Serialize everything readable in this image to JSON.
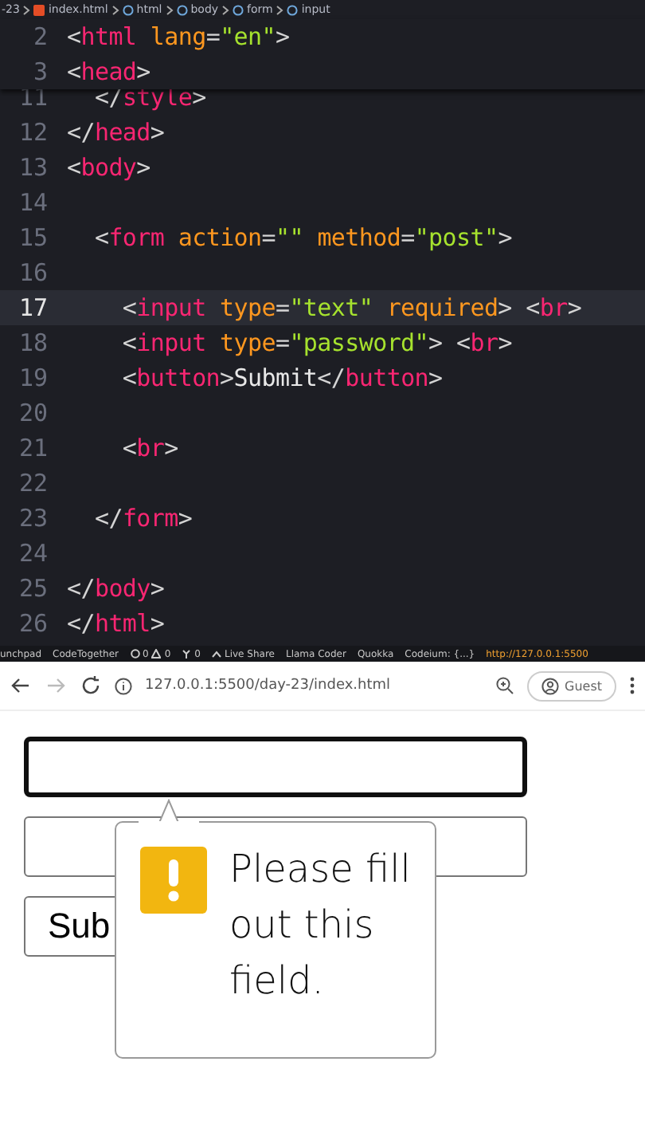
{
  "breadcrumb": [
    {
      "kind": "folder",
      "label": "-23"
    },
    {
      "kind": "file",
      "label": "index.html"
    },
    {
      "kind": "element",
      "label": "html"
    },
    {
      "kind": "element",
      "label": "body"
    },
    {
      "kind": "element",
      "label": "form"
    },
    {
      "kind": "element",
      "label": "input"
    }
  ],
  "sticky_lines": [
    {
      "number": "2",
      "current": false,
      "tokens": [
        {
          "kind": "punct",
          "text": "<"
        },
        {
          "kind": "tag",
          "text": "html"
        },
        {
          "kind": "attr",
          "text": " lang"
        },
        {
          "kind": "punct",
          "text": "="
        },
        {
          "kind": "string",
          "text": "\"en\""
        },
        {
          "kind": "punct",
          "text": ">"
        }
      ]
    },
    {
      "number": "3",
      "current": false,
      "tokens": [
        {
          "kind": "punct",
          "text": "<"
        },
        {
          "kind": "tag",
          "text": "head"
        },
        {
          "kind": "punct",
          "text": ">"
        }
      ]
    }
  ],
  "code_lines": [
    {
      "number": "11",
      "current": false,
      "tokens": [
        {
          "kind": "punct",
          "text": "  </"
        },
        {
          "kind": "tag",
          "text": "style"
        },
        {
          "kind": "punct",
          "text": ">"
        }
      ]
    },
    {
      "number": "12",
      "current": false,
      "tokens": [
        {
          "kind": "punct",
          "text": "</"
        },
        {
          "kind": "tag",
          "text": "head"
        },
        {
          "kind": "punct",
          "text": ">"
        }
      ]
    },
    {
      "number": "13",
      "current": false,
      "tokens": [
        {
          "kind": "punct",
          "text": "<"
        },
        {
          "kind": "tag",
          "text": "body"
        },
        {
          "kind": "punct",
          "text": ">"
        }
      ]
    },
    {
      "number": "14",
      "current": false
    },
    {
      "number": "15",
      "current": false,
      "tokens": [
        {
          "kind": "punct",
          "text": "  <"
        },
        {
          "kind": "tag",
          "text": "form"
        },
        {
          "kind": "attr",
          "text": " action"
        },
        {
          "kind": "punct",
          "text": "="
        },
        {
          "kind": "string",
          "text": "\"\""
        },
        {
          "kind": "attr",
          "text": " method"
        },
        {
          "kind": "punct",
          "text": "="
        },
        {
          "kind": "string",
          "text": "\"post\""
        },
        {
          "kind": "punct",
          "text": ">"
        }
      ]
    },
    {
      "number": "16",
      "current": false
    },
    {
      "number": "17",
      "current": true,
      "tokens": [
        {
          "kind": "punct",
          "text": "    <"
        },
        {
          "kind": "tag",
          "text": "input"
        },
        {
          "kind": "attr",
          "text": " type"
        },
        {
          "kind": "punct",
          "text": "="
        },
        {
          "kind": "string",
          "text": "\"text\""
        },
        {
          "kind": "attr",
          "text": " required"
        },
        {
          "kind": "punct",
          "text": "> <"
        },
        {
          "kind": "tag",
          "text": "br"
        },
        {
          "kind": "punct",
          "text": ">"
        }
      ]
    },
    {
      "number": "18",
      "current": false,
      "tokens": [
        {
          "kind": "punct",
          "text": "    <"
        },
        {
          "kind": "tag",
          "text": "input"
        },
        {
          "kind": "attr",
          "text": " type"
        },
        {
          "kind": "punct",
          "text": "="
        },
        {
          "kind": "string",
          "text": "\"password\""
        },
        {
          "kind": "punct",
          "text": "> <"
        },
        {
          "kind": "tag",
          "text": "br"
        },
        {
          "kind": "punct",
          "text": ">"
        }
      ]
    },
    {
      "number": "19",
      "current": false,
      "tokens": [
        {
          "kind": "punct",
          "text": "    <"
        },
        {
          "kind": "tag",
          "text": "button"
        },
        {
          "kind": "punct",
          "text": ">"
        },
        {
          "kind": "text",
          "text": "Submit"
        },
        {
          "kind": "punct",
          "text": "</"
        },
        {
          "kind": "tag",
          "text": "button"
        },
        {
          "kind": "punct",
          "text": ">"
        }
      ]
    },
    {
      "number": "20",
      "current": false
    },
    {
      "number": "21",
      "current": false,
      "tokens": [
        {
          "kind": "punct",
          "text": "    <"
        },
        {
          "kind": "tag",
          "text": "br"
        },
        {
          "kind": "punct",
          "text": ">"
        }
      ]
    },
    {
      "number": "22",
      "current": false
    },
    {
      "number": "23",
      "current": false,
      "tokens": [
        {
          "kind": "punct",
          "text": "  </"
        },
        {
          "kind": "tag",
          "text": "form"
        },
        {
          "kind": "punct",
          "text": ">"
        }
      ]
    },
    {
      "number": "24",
      "current": false
    },
    {
      "number": "25",
      "current": false,
      "tokens": [
        {
          "kind": "punct",
          "text": "</"
        },
        {
          "kind": "tag",
          "text": "body"
        },
        {
          "kind": "punct",
          "text": ">"
        }
      ]
    },
    {
      "number": "26",
      "current": false,
      "tokens": [
        {
          "kind": "punct",
          "text": "</"
        },
        {
          "kind": "tag",
          "text": "html"
        },
        {
          "kind": "punct",
          "text": ">"
        }
      ]
    }
  ],
  "status_bar": [
    {
      "kind": "text",
      "label": "unchpad"
    },
    {
      "kind": "text",
      "label": "CodeTogether"
    },
    {
      "kind": "problems",
      "label": "0",
      "label2": "0"
    },
    {
      "kind": "ports",
      "label": "0"
    },
    {
      "kind": "liveshare",
      "label": "Live Share"
    },
    {
      "kind": "text",
      "label": "Llama Coder"
    },
    {
      "kind": "text",
      "label": "Quokka"
    },
    {
      "kind": "text",
      "label": "Codeium: {...}"
    },
    {
      "kind": "server",
      "label": "http://127.0.0.1:5500"
    }
  ],
  "browser": {
    "back_disabled": false,
    "forward_disabled": true,
    "url": "127.0.0.1:5500/day-23/index.html",
    "profile": "Guest"
  },
  "page": {
    "text_input": {
      "focused": true
    },
    "password_input": {
      "focused": false
    },
    "submit_button": "Sub",
    "validation_message": "Please fill out this field."
  }
}
